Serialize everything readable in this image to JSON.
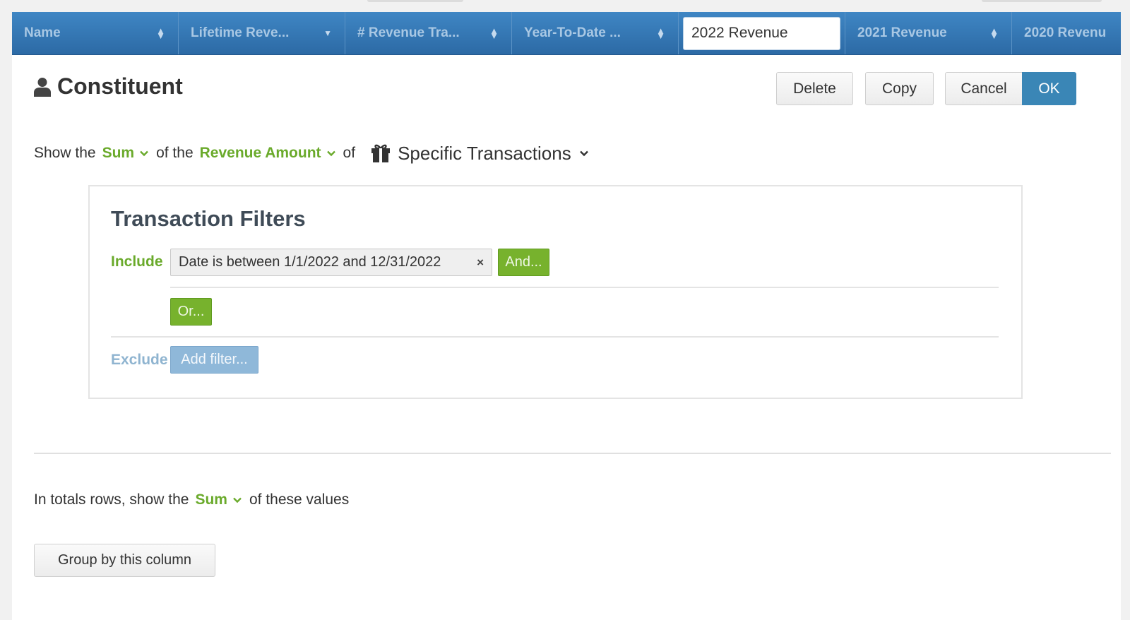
{
  "columns": [
    {
      "label": "Name",
      "indicator": "sort"
    },
    {
      "label": "Lifetime Reve...",
      "indicator": "caret"
    },
    {
      "label": "# Revenue Tra...",
      "indicator": "sort"
    },
    {
      "label": "Year-To-Date ...",
      "indicator": "sort"
    },
    {
      "label": "2022 Revenue",
      "indicator": "editing"
    },
    {
      "label": "2021 Revenue",
      "indicator": "sort"
    },
    {
      "label": "2020 Revenu",
      "indicator": "none"
    }
  ],
  "editor": {
    "title": "Constituent",
    "buttons": {
      "delete": "Delete",
      "copy": "Copy",
      "cancel": "Cancel",
      "ok": "OK"
    },
    "sentence": {
      "show_the": "Show the",
      "aggregate": "Sum",
      "of_the": "of the",
      "field": "Revenue Amount",
      "of": "of",
      "source": "Specific Transactions"
    },
    "filters": {
      "heading": "Transaction Filters",
      "include_label": "Include",
      "include_chip": "Date is between 1/1/2022 and 12/31/2022",
      "remove_symbol": "×",
      "and_button": "And...",
      "or_button": "Or...",
      "exclude_label": "Exclude",
      "add_filter_button": "Add filter..."
    },
    "totals": {
      "prefix": "In totals rows, show the",
      "aggregate": "Sum",
      "suffix": "of these values"
    },
    "group_button": "Group by this column"
  },
  "colors": {
    "header_blue": "#3479b8",
    "accent_green": "#6aaa2b",
    "ok_blue": "#3a86b6",
    "exclude_blue": "#8fb4d0"
  },
  "icons": {
    "title_icon": "person-icon",
    "source_icon": "gift-icon"
  }
}
